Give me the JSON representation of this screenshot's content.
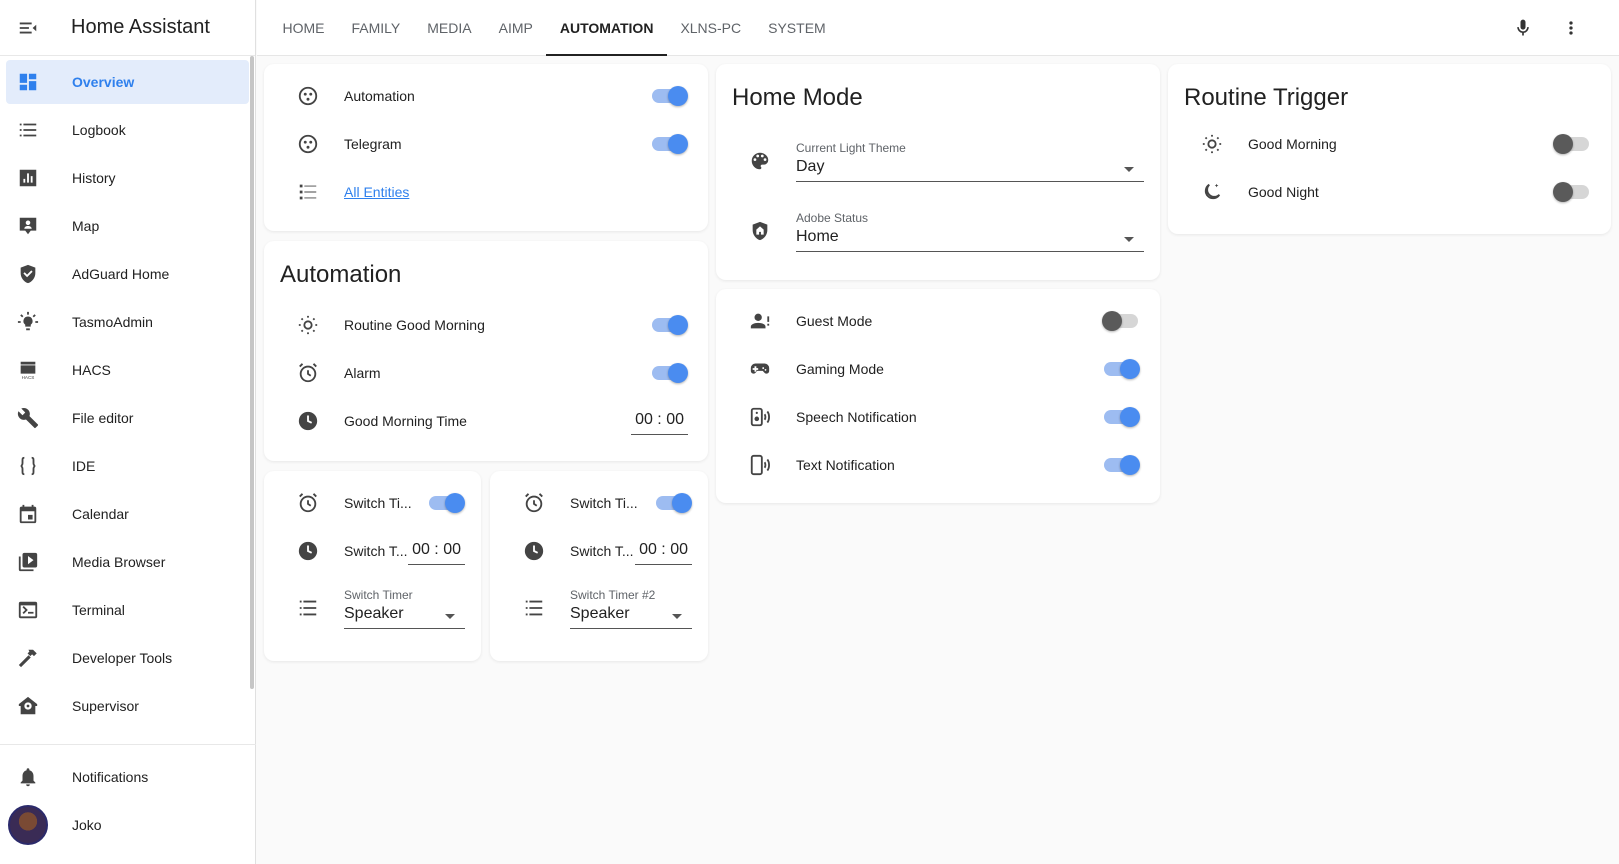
{
  "app": {
    "title": "Home Assistant"
  },
  "sidebar": {
    "items": [
      {
        "label": "Overview",
        "icon": "overview-icon"
      },
      {
        "label": "Logbook",
        "icon": "logbook-icon"
      },
      {
        "label": "History",
        "icon": "history-icon"
      },
      {
        "label": "Map",
        "icon": "map-icon"
      },
      {
        "label": "AdGuard Home",
        "icon": "shield-check-icon"
      },
      {
        "label": "TasmoAdmin",
        "icon": "lightbulb-icon"
      },
      {
        "label": "HACS",
        "icon": "hacs-icon"
      },
      {
        "label": "File editor",
        "icon": "wrench-icon"
      },
      {
        "label": "IDE",
        "icon": "code-braces-icon"
      },
      {
        "label": "Calendar",
        "icon": "calendar-icon"
      },
      {
        "label": "Media Browser",
        "icon": "media-browser-icon"
      },
      {
        "label": "Terminal",
        "icon": "terminal-icon"
      },
      {
        "label": "Developer Tools",
        "icon": "hammer-icon"
      },
      {
        "label": "Supervisor",
        "icon": "supervisor-icon"
      }
    ],
    "notifications_label": "Notifications",
    "user_label": "Joko"
  },
  "toolbar": {
    "tabs": [
      "HOME",
      "FAMILY",
      "MEDIA",
      "AIMP",
      "AUTOMATION",
      "XLNS-PC",
      "SYSTEM"
    ],
    "active_tab": "AUTOMATION"
  },
  "card_entities": {
    "rows": [
      {
        "label": "Automation",
        "state": "on"
      },
      {
        "label": "Telegram",
        "state": "on"
      }
    ],
    "link_label": "All Entities"
  },
  "card_automation": {
    "title": "Automation",
    "rows": [
      {
        "label": "Routine Good Morning",
        "state": "on"
      },
      {
        "label": "Alarm",
        "state": "on"
      },
      {
        "label": "Good Morning Time",
        "time": "00 : 00"
      }
    ]
  },
  "card_timer1": {
    "switch_label": "Switch Ti...",
    "switch_state": "on",
    "time_label": "Switch T...",
    "time": "00 : 00",
    "select_label": "Switch Timer",
    "select_value": "Speaker"
  },
  "card_timer2": {
    "switch_label": "Switch Ti...",
    "switch_state": "on",
    "time_label": "Switch T...",
    "time": "00 : 00",
    "select_label": "Switch Timer #2",
    "select_value": "Speaker"
  },
  "card_home_mode": {
    "title": "Home Mode",
    "theme_label": "Current Light Theme",
    "theme_value": "Day",
    "adobe_label": "Adobe Status",
    "adobe_value": "Home"
  },
  "card_modes": {
    "rows": [
      {
        "label": "Guest Mode",
        "state": "off"
      },
      {
        "label": "Gaming Mode",
        "state": "on"
      },
      {
        "label": "Speech Notification",
        "state": "on"
      },
      {
        "label": "Text Notification",
        "state": "on"
      }
    ]
  },
  "card_routine": {
    "title": "Routine Trigger",
    "rows": [
      {
        "label": "Good Morning",
        "state": "off"
      },
      {
        "label": "Good Night",
        "state": "off"
      }
    ]
  },
  "colors": {
    "accent": "#4a8cf0",
    "active_bg": "#e3ecfb",
    "background": "#fafafa"
  }
}
